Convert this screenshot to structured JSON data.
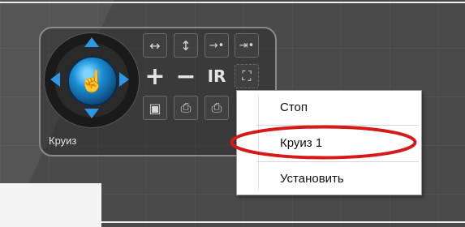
{
  "ptz_panel": {
    "label": "Круиз",
    "buttons": {
      "horizontal_scan": "↔",
      "vertical_scan": "↕",
      "goto_preset": "→•",
      "set_preset": "⇥•",
      "zoom_in": "+",
      "zoom_out": "−",
      "ir": "IR",
      "fit": "⛶",
      "image": "▣",
      "tour_lock": "⎙",
      "record_lock": "⎙"
    },
    "joystick": {
      "up_icon": "arrow-up-icon",
      "down_icon": "arrow-down-icon",
      "left_icon": "arrow-left-icon",
      "right_icon": "arrow-right-icon",
      "center_symbol": "☝"
    },
    "accent_color": "#2b97e6"
  },
  "context_menu": {
    "items": [
      {
        "label": "Стоп"
      },
      {
        "label": "Круиз 1"
      },
      {
        "label": "Установить"
      }
    ],
    "highlight_color": "#d61a1a"
  }
}
